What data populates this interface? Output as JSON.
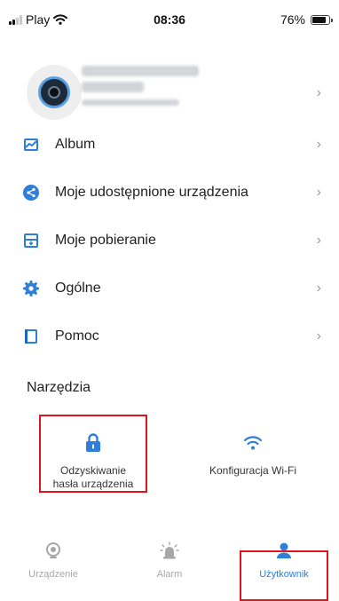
{
  "status_bar": {
    "carrier": "Play",
    "time": "08:36",
    "battery": "76%",
    "battery_level": 0.76
  },
  "profile": {
    "chevron": "›"
  },
  "menu": [
    {
      "label": "Album",
      "icon": "album-icon",
      "chevron": "›"
    },
    {
      "label": "Moje udostępnione urządzenia",
      "icon": "share-icon",
      "chevron": "›"
    },
    {
      "label": "Moje pobieranie",
      "icon": "download-icon",
      "chevron": "›"
    },
    {
      "label": "Ogólne",
      "icon": "gear-icon",
      "chevron": "›"
    },
    {
      "label": "Pomoc",
      "icon": "book-icon",
      "chevron": "›"
    }
  ],
  "tools": {
    "title": "Narzędzia",
    "items": [
      {
        "label_line1": "Odzyskiwanie",
        "label_line2": "hasła urządzenia",
        "icon": "lock-icon"
      },
      {
        "label_line1": "Konfiguracja Wi-Fi",
        "icon": "wifi-icon"
      }
    ]
  },
  "tabbar": {
    "tabs": [
      {
        "label": "Urządzenie",
        "icon": "camera-icon",
        "active": false
      },
      {
        "label": "Alarm",
        "icon": "alarm-icon",
        "active": false
      },
      {
        "label": "Użytkownik",
        "icon": "user-icon",
        "active": true
      }
    ]
  },
  "colors": {
    "accent": "#2f7fd9",
    "highlight": "#e0141e",
    "inactive": "#a7a7a7"
  }
}
